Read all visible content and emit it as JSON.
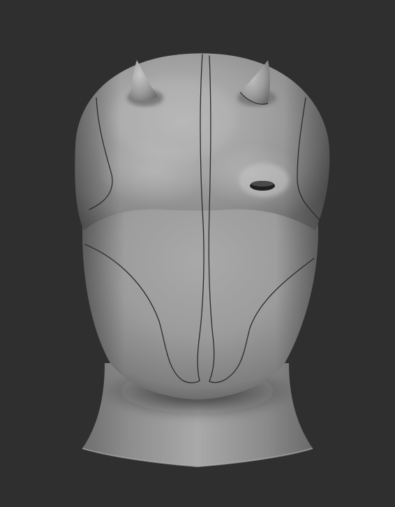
{
  "scene": {
    "background_color": "#2f2f2f",
    "material_color": "#9a9a9a",
    "subject": "sculpted-head-model"
  }
}
